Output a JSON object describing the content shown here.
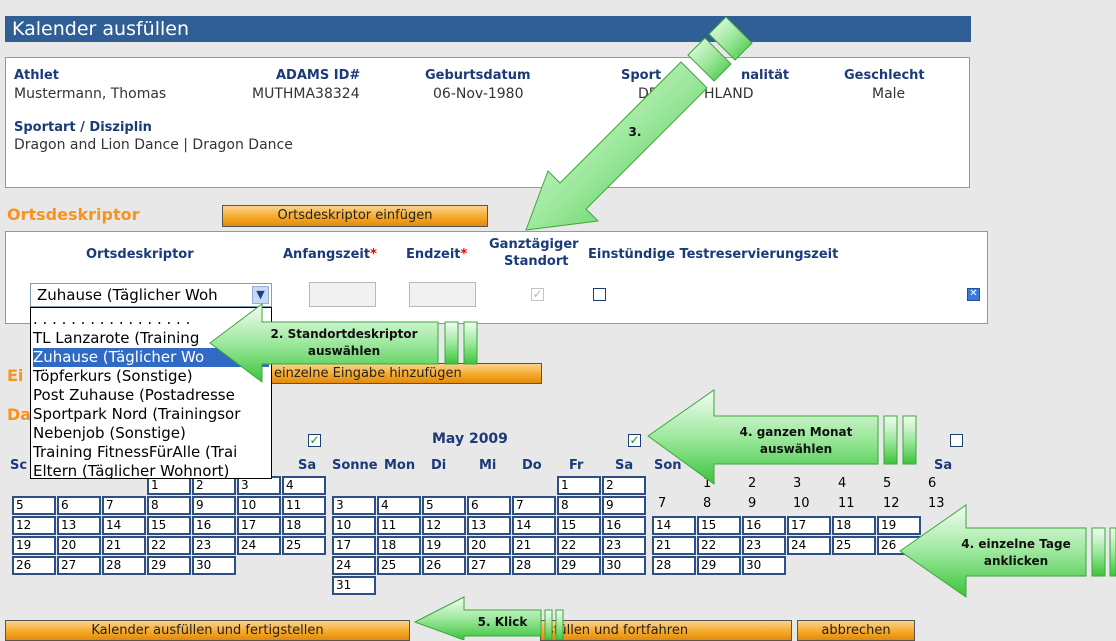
{
  "page_title": "Kalender ausfüllen",
  "athlete": {
    "athlet_label": "Athlet",
    "athlet_value": "Mustermann, Thomas",
    "adams_label": "ADAMS ID#",
    "adams_value": "MUTHMA38324",
    "geburt_label": "Geburtsdatum",
    "geburt_value": "06-Nov-1980",
    "nation_label": "Sport",
    "nation_label2": "nalität",
    "nation_value1": "DE",
    "nation_value2": "HLAND",
    "geschlecht_label": "Geschlecht",
    "geschlecht_value": "Male",
    "sportart_label": "Sportart / Disziplin",
    "sportart_value": "Dragon and Lion Dance | Dragon Dance"
  },
  "ortsdeskriptor": {
    "section_title": "Ortsdeskriptor",
    "insert_button": "Ortsdeskriptor einfügen",
    "col_ortsdeskriptor": "Ortsdeskriptor",
    "col_anfangszeit": "Anfangszeit",
    "col_endzeit": "Endzeit",
    "required_mark": "*",
    "col_ganztaegig_1": "Ganztägiger",
    "col_ganztaegig_2": "Standort",
    "col_testzeit": "Einstündige Testreservierungszeit",
    "selected_value": "Zuhause (Täglicher Woh",
    "options": [
      ". . . . . . . . . . . . . . . . .",
      "TL Lanzarote (Training",
      "Zuhause (Täglicher Wo",
      "Töpferkurs (Sonstige)",
      "Post Zuhause (Postadresse",
      "Sportpark Nord (Trainingsor",
      "Nebenjob (Sonstige)",
      "Training FitnessFürAlle (Trai",
      "Eltern (Täglicher Wohnort)"
    ],
    "selected_index": 2,
    "ganztaegig_checked": true,
    "testzeit_checked": false,
    "remove_icon": "close-icon"
  },
  "einzelne": {
    "section_partial": "Ei",
    "add_button": "einzelne Eingabe hinzufügen"
  },
  "dates_section_partial": "Da",
  "calendar": {
    "month_april_select_checked": true,
    "may": {
      "title": "May 2009",
      "select_all_checked": true,
      "headers": [
        "Sonne",
        "Mon",
        "Di",
        "Mi",
        "Do",
        "Fr",
        "Sa"
      ],
      "weeks": [
        [
          "",
          "",
          "",
          "",
          "",
          "1",
          "2"
        ],
        [
          "3",
          "4",
          "5",
          "6",
          "7",
          "8",
          "9"
        ],
        [
          "10",
          "11",
          "12",
          "13",
          "14",
          "15",
          "16"
        ],
        [
          "17",
          "18",
          "19",
          "20",
          "21",
          "22",
          "23"
        ],
        [
          "24",
          "25",
          "26",
          "27",
          "28",
          "29",
          "30"
        ],
        [
          "31",
          "",
          "",
          "",
          "",
          "",
          ""
        ]
      ]
    },
    "april": {
      "headers_partial": [
        "Sc",
        "Sa"
      ],
      "weeks": [
        [
          "",
          "",
          "",
          "1",
          "2",
          "3",
          "4"
        ],
        [
          "5",
          "6",
          "7",
          "8",
          "9",
          "10",
          "11"
        ],
        [
          "12",
          "13",
          "14",
          "15",
          "16",
          "17",
          "18"
        ],
        [
          "19",
          "20",
          "21",
          "22",
          "23",
          "24",
          "25"
        ],
        [
          "26",
          "27",
          "28",
          "29",
          "30",
          "",
          ""
        ]
      ]
    },
    "june": {
      "select_all_checked": false,
      "headers_partial": [
        "Son",
        "Sa"
      ],
      "weeks": [
        [
          "",
          "1",
          "2",
          "3",
          "4",
          "5",
          "6"
        ],
        [
          "7",
          "8",
          "9",
          "10",
          "11",
          "12",
          "13"
        ],
        [
          "14",
          "15",
          "16",
          "17",
          "18",
          "19",
          ""
        ],
        [
          "21",
          "22",
          "23",
          "24",
          "25",
          "26",
          ""
        ],
        [
          "28",
          "29",
          "30",
          "",
          "",
          "",
          ""
        ]
      ]
    }
  },
  "buttons": {
    "finish": "Kalender ausfüllen und fertigstellen",
    "continue_partial": "sfüllen und fortfahren",
    "cancel": "abbrechen"
  },
  "annotations": {
    "step2_line1": "2. Standortdeskriptor",
    "step2_line2": "auswählen",
    "step3": "3.",
    "step4_line1": "4. ganzen Monat",
    "step4_line2": "auswählen",
    "step4b_line1": "4. einzelne Tage",
    "step4b_line2": "anklicken",
    "step5": "5. Klick"
  },
  "colors": {
    "title_bar": "#2f5f95",
    "accent_orange": "#f7941d",
    "label_blue": "#1a3a7a",
    "arrow_green": "#66dd66",
    "arrow_light": "#d9f7d9",
    "calendar_border": "#2d4f85"
  }
}
